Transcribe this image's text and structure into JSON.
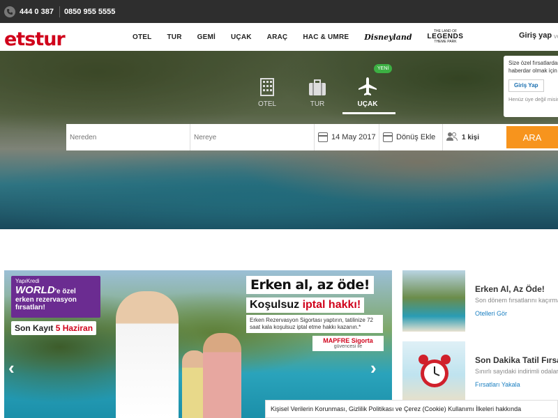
{
  "topbar": {
    "phone1": "444 0 387",
    "phone2": "0850 955 5555"
  },
  "nav": {
    "logo": "etstur",
    "items": [
      "OTEL",
      "TUR",
      "GEMİ",
      "UÇAK",
      "ARAÇ",
      "HAC & UMRE"
    ],
    "disney": "Disneyland",
    "legends_top": "THE LAND OF",
    "legends": "LEGENDS",
    "legends_bottom": "THEME PARK",
    "login": "Giriş yap",
    "login_extra": "ve"
  },
  "hero": {
    "tabs": [
      {
        "label": "OTEL",
        "icon": "building-icon"
      },
      {
        "label": "TUR",
        "icon": "suitcase-icon"
      },
      {
        "label": "UÇAK",
        "icon": "plane-icon"
      }
    ],
    "active_tab": "UÇAK",
    "new_badge": "YENİ",
    "search": {
      "from_placeholder": "Nereden",
      "to_placeholder": "Nereye",
      "date": "14 May 2017",
      "return": "Dönüş Ekle",
      "passengers": "1 kişi",
      "submit": "ARA"
    },
    "login_popup": {
      "line1": "Size özel fırsatlardan",
      "line2": "haberdar olmak için",
      "button": "Giriş Yap",
      "footer": "Henüz üye değil misiniz?"
    }
  },
  "banner": {
    "yk_brand": "YapıKredi",
    "yk_world": "WORLD",
    "yk_suffix": "'e özel",
    "yk_line2": "erken rezervasyon",
    "yk_line3": "fırsatları!",
    "son_kayit": "Son Kayıt",
    "son_kayit_date": "5 Haziran",
    "erken_al": "Erken al, az öde!",
    "kosulsuz": "Koşulsuz",
    "iptal": "iptal hakkı!",
    "desc": "Erken Rezervasyon Sigortası yaptırın, tatilinize 72 saat kala koşulsuz iptal etme hakkı kazanın.*",
    "mapfre": "MAPFRE Sigorta",
    "mapfre_sub": "güvencesi ile"
  },
  "side_cards": [
    {
      "title": "Erken Al, Az Öde!",
      "desc": "Son dönem fırsatlarını kaçırmayın",
      "link": "Otelleri Gör"
    },
    {
      "title": "Son Dakika Tatil Fırsatları",
      "desc": "Sınırlı sayıdaki indirimli odalar",
      "link": "Fırsatları Yakala"
    }
  ],
  "cookie": "Kişisel Verilerin Korunması, Gizlilik Politikası ve Çerez (Cookie) Kullanımı İlkeleri hakkında",
  "colors": {
    "brand_red": "#d0021b",
    "search_orange": "#f7941d",
    "new_green": "#3cb043",
    "link_blue": "#1a7fc1"
  }
}
